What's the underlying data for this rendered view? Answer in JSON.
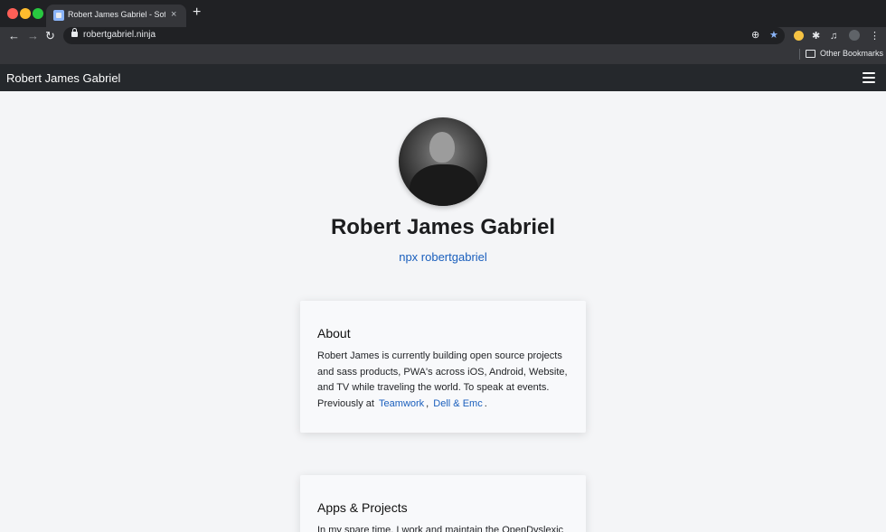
{
  "browser": {
    "tab_title": "Robert James Gabriel - Software",
    "tab_close": "×",
    "new_tab": "+",
    "url": "robertgabriel.ninja",
    "back": "←",
    "forward": "→",
    "reload": "↻",
    "add_icon": "⊕",
    "star": "★",
    "puzzle": "✱",
    "media": "♫",
    "menu": "⋮",
    "bookmarks_label": "Other Bookmarks"
  },
  "site": {
    "brand": "Robert James Gabriel",
    "name": "Robert James Gabriel",
    "npx": "npx robertgabriel",
    "about": {
      "heading": "About",
      "text": "Robert James is currently building open source projects and sass products, PWA's across iOS, Android, Website, and TV while traveling the world. To speak at events. Previously at",
      "link1": "Teamwork",
      "sep": ",",
      "link2": "Dell & Emc",
      "end": "."
    },
    "apps": {
      "heading": "Apps & Projects",
      "text": "In my spare time, I work and maintain the OpenDyslexic"
    }
  },
  "colors": {
    "link": "#1a5fbd",
    "navbar": "#25282c",
    "page_bg": "#f4f5f7"
  }
}
